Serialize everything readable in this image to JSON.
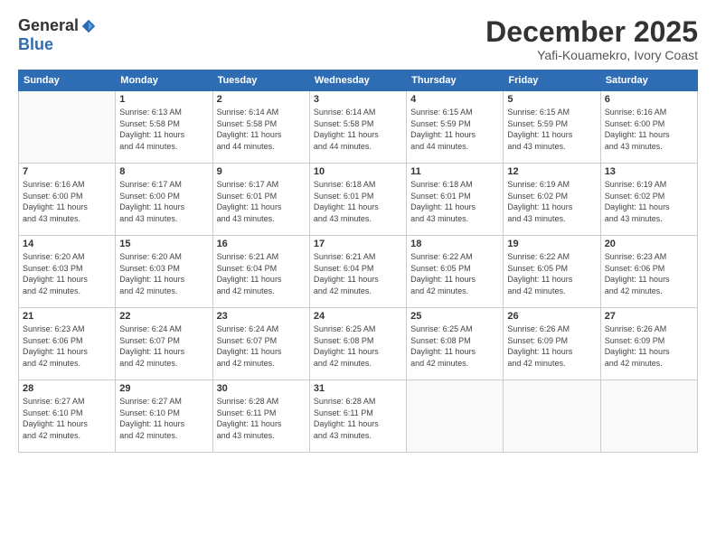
{
  "header": {
    "logo_general": "General",
    "logo_blue": "Blue",
    "month_title": "December 2025",
    "location": "Yafi-Kouamekro, Ivory Coast"
  },
  "weekdays": [
    "Sunday",
    "Monday",
    "Tuesday",
    "Wednesday",
    "Thursday",
    "Friday",
    "Saturday"
  ],
  "weeks": [
    [
      {
        "day": "",
        "info": ""
      },
      {
        "day": "1",
        "info": "Sunrise: 6:13 AM\nSunset: 5:58 PM\nDaylight: 11 hours\nand 44 minutes."
      },
      {
        "day": "2",
        "info": "Sunrise: 6:14 AM\nSunset: 5:58 PM\nDaylight: 11 hours\nand 44 minutes."
      },
      {
        "day": "3",
        "info": "Sunrise: 6:14 AM\nSunset: 5:58 PM\nDaylight: 11 hours\nand 44 minutes."
      },
      {
        "day": "4",
        "info": "Sunrise: 6:15 AM\nSunset: 5:59 PM\nDaylight: 11 hours\nand 44 minutes."
      },
      {
        "day": "5",
        "info": "Sunrise: 6:15 AM\nSunset: 5:59 PM\nDaylight: 11 hours\nand 43 minutes."
      },
      {
        "day": "6",
        "info": "Sunrise: 6:16 AM\nSunset: 6:00 PM\nDaylight: 11 hours\nand 43 minutes."
      }
    ],
    [
      {
        "day": "7",
        "info": "Sunrise: 6:16 AM\nSunset: 6:00 PM\nDaylight: 11 hours\nand 43 minutes."
      },
      {
        "day": "8",
        "info": "Sunrise: 6:17 AM\nSunset: 6:00 PM\nDaylight: 11 hours\nand 43 minutes."
      },
      {
        "day": "9",
        "info": "Sunrise: 6:17 AM\nSunset: 6:01 PM\nDaylight: 11 hours\nand 43 minutes."
      },
      {
        "day": "10",
        "info": "Sunrise: 6:18 AM\nSunset: 6:01 PM\nDaylight: 11 hours\nand 43 minutes."
      },
      {
        "day": "11",
        "info": "Sunrise: 6:18 AM\nSunset: 6:01 PM\nDaylight: 11 hours\nand 43 minutes."
      },
      {
        "day": "12",
        "info": "Sunrise: 6:19 AM\nSunset: 6:02 PM\nDaylight: 11 hours\nand 43 minutes."
      },
      {
        "day": "13",
        "info": "Sunrise: 6:19 AM\nSunset: 6:02 PM\nDaylight: 11 hours\nand 43 minutes."
      }
    ],
    [
      {
        "day": "14",
        "info": "Sunrise: 6:20 AM\nSunset: 6:03 PM\nDaylight: 11 hours\nand 42 minutes."
      },
      {
        "day": "15",
        "info": "Sunrise: 6:20 AM\nSunset: 6:03 PM\nDaylight: 11 hours\nand 42 minutes."
      },
      {
        "day": "16",
        "info": "Sunrise: 6:21 AM\nSunset: 6:04 PM\nDaylight: 11 hours\nand 42 minutes."
      },
      {
        "day": "17",
        "info": "Sunrise: 6:21 AM\nSunset: 6:04 PM\nDaylight: 11 hours\nand 42 minutes."
      },
      {
        "day": "18",
        "info": "Sunrise: 6:22 AM\nSunset: 6:05 PM\nDaylight: 11 hours\nand 42 minutes."
      },
      {
        "day": "19",
        "info": "Sunrise: 6:22 AM\nSunset: 6:05 PM\nDaylight: 11 hours\nand 42 minutes."
      },
      {
        "day": "20",
        "info": "Sunrise: 6:23 AM\nSunset: 6:06 PM\nDaylight: 11 hours\nand 42 minutes."
      }
    ],
    [
      {
        "day": "21",
        "info": "Sunrise: 6:23 AM\nSunset: 6:06 PM\nDaylight: 11 hours\nand 42 minutes."
      },
      {
        "day": "22",
        "info": "Sunrise: 6:24 AM\nSunset: 6:07 PM\nDaylight: 11 hours\nand 42 minutes."
      },
      {
        "day": "23",
        "info": "Sunrise: 6:24 AM\nSunset: 6:07 PM\nDaylight: 11 hours\nand 42 minutes."
      },
      {
        "day": "24",
        "info": "Sunrise: 6:25 AM\nSunset: 6:08 PM\nDaylight: 11 hours\nand 42 minutes."
      },
      {
        "day": "25",
        "info": "Sunrise: 6:25 AM\nSunset: 6:08 PM\nDaylight: 11 hours\nand 42 minutes."
      },
      {
        "day": "26",
        "info": "Sunrise: 6:26 AM\nSunset: 6:09 PM\nDaylight: 11 hours\nand 42 minutes."
      },
      {
        "day": "27",
        "info": "Sunrise: 6:26 AM\nSunset: 6:09 PM\nDaylight: 11 hours\nand 42 minutes."
      }
    ],
    [
      {
        "day": "28",
        "info": "Sunrise: 6:27 AM\nSunset: 6:10 PM\nDaylight: 11 hours\nand 42 minutes."
      },
      {
        "day": "29",
        "info": "Sunrise: 6:27 AM\nSunset: 6:10 PM\nDaylight: 11 hours\nand 42 minutes."
      },
      {
        "day": "30",
        "info": "Sunrise: 6:28 AM\nSunset: 6:11 PM\nDaylight: 11 hours\nand 43 minutes."
      },
      {
        "day": "31",
        "info": "Sunrise: 6:28 AM\nSunset: 6:11 PM\nDaylight: 11 hours\nand 43 minutes."
      },
      {
        "day": "",
        "info": ""
      },
      {
        "day": "",
        "info": ""
      },
      {
        "day": "",
        "info": ""
      }
    ]
  ]
}
